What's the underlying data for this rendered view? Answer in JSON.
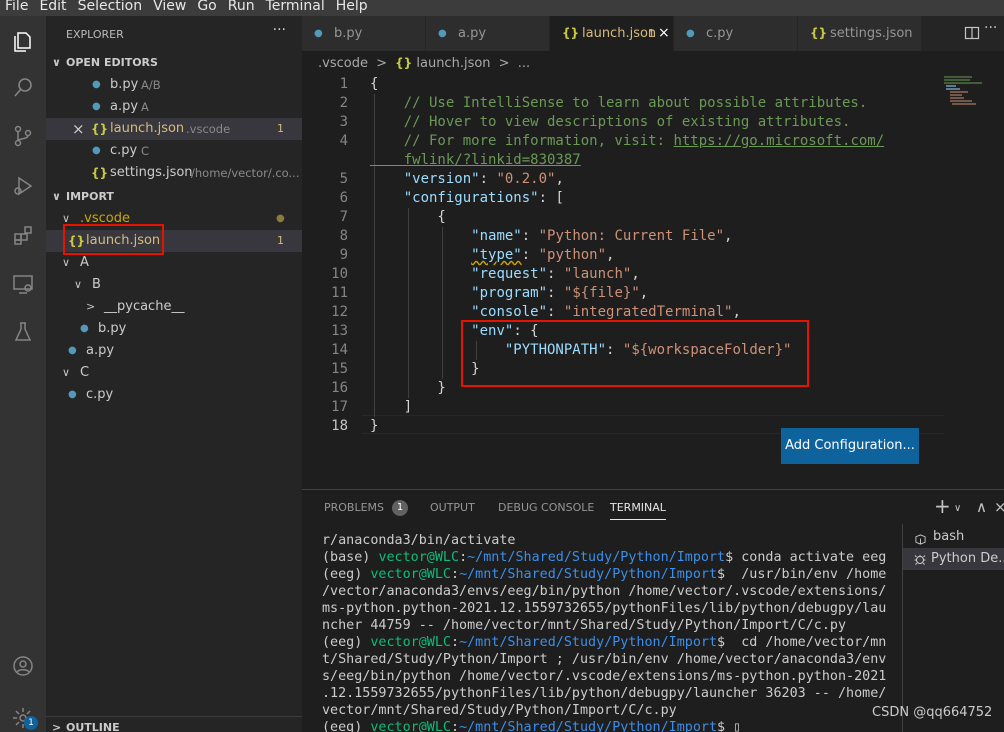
{
  "menu": [
    "File",
    "Edit",
    "Selection",
    "View",
    "Go",
    "Run",
    "Terminal",
    "Help"
  ],
  "activity_badge": "1",
  "explorer": {
    "title": "EXPLORER",
    "more": "···",
    "open_editors_header": "OPEN EDITORS",
    "open_editors": [
      {
        "icon": "py",
        "name": "b.py",
        "desc": "A/B",
        "num": ""
      },
      {
        "icon": "py",
        "name": "a.py",
        "desc": "A",
        "num": ""
      },
      {
        "icon": "json",
        "name": "launch.json",
        "desc": ".vscode",
        "num": "1"
      },
      {
        "icon": "py",
        "name": "c.py",
        "desc": "C",
        "num": ""
      },
      {
        "icon": "json",
        "name": "settings.json",
        "desc": "/home/vector/.co...",
        "num": ""
      }
    ],
    "folder_header": "IMPORT",
    "tree": [
      {
        "type": "folder",
        "name": ".vscode",
        "dot": true
      },
      {
        "type": "json",
        "name": "launch.json",
        "num": "1"
      },
      {
        "type": "folder",
        "name": "A"
      },
      {
        "type": "folder",
        "name": "B"
      },
      {
        "type": "folder-collapsed",
        "name": "__pycache__"
      },
      {
        "type": "py",
        "name": "b.py"
      },
      {
        "type": "py",
        "name": "a.py"
      },
      {
        "type": "folder",
        "name": "C"
      },
      {
        "type": "py",
        "name": "c.py"
      }
    ],
    "outline_header": "OUTLINE"
  },
  "tabs": [
    {
      "icon": "py",
      "label": "b.py"
    },
    {
      "icon": "py",
      "label": "a.py"
    },
    {
      "icon": "json",
      "label": "launch.json",
      "num": "1",
      "close": "×",
      "active": true
    },
    {
      "icon": "py",
      "label": "c.py"
    },
    {
      "icon": "json",
      "label": "settings.json"
    }
  ],
  "tabs_more": "···",
  "breadcrumb": {
    "folder": ".vscode",
    "sep": ">",
    "file_icon": "{}",
    "file": "launch.json",
    "more": "..."
  },
  "editor": {
    "line_numbers": [
      "1",
      "2",
      "3",
      "4",
      "",
      "5",
      "6",
      "7",
      "8",
      "9",
      "10",
      "11",
      "12",
      "13",
      "14",
      "15",
      "16",
      "17",
      "18"
    ],
    "lines": [
      "{",
      "    // Use IntelliSense to learn about possible attributes.",
      "    // Hover to view descriptions of existing attributes.",
      "    // For more information, visit: ",
      "    fwlink/?linkid=830387",
      "    \"version\": \"0.2.0\",",
      "    \"configurations\": [",
      "        {",
      "            \"name\": \"Python: Current File\",",
      "            \"type\": \"python\",",
      "            \"request\": \"launch\",",
      "            \"program\": \"${file}\",",
      "            \"console\": \"integratedTerminal\",",
      "            \"env\": {",
      "                \"PYTHONPATH\": \"${workspaceFolder}\"",
      "            }",
      "        }",
      "    ]",
      "}"
    ],
    "url": "https://go.microsoft.com/",
    "add_configuration": "Add Configuration..."
  },
  "panel": {
    "tabs": [
      "PROBLEMS",
      "OUTPUT",
      "DEBUG CONSOLE",
      "TERMINAL"
    ],
    "problems_count": "1",
    "new_terminal": "+",
    "terminals": [
      {
        "icon": "terminal-icon",
        "label": "bash"
      },
      {
        "icon": "debug-icon",
        "label": "Python De..."
      }
    ],
    "terminal_lines": [
      [
        {
          "t": "r/anaconda3/bin/activate",
          "c": ""
        }
      ],
      [
        {
          "t": "(base) ",
          "c": ""
        },
        {
          "t": "vector@WLC",
          "c": "tg"
        },
        {
          "t": ":",
          "c": ""
        },
        {
          "t": "~/mnt/Shared/Study/Python/Import",
          "c": "tb"
        },
        {
          "t": "$ conda activate eeg",
          "c": ""
        }
      ],
      [
        {
          "t": "(eeg) ",
          "c": ""
        },
        {
          "t": "vector@WLC",
          "c": "tg"
        },
        {
          "t": ":",
          "c": ""
        },
        {
          "t": "~/mnt/Shared/Study/Python/Import",
          "c": "tb"
        },
        {
          "t": "$  /usr/bin/env /home",
          "c": ""
        }
      ],
      [
        {
          "t": "/vector/anaconda3/envs/eeg/bin/python /home/vector/.vscode/extensions/",
          "c": ""
        }
      ],
      [
        {
          "t": "ms-python.python-2021.12.1559732655/pythonFiles/lib/python/debugpy/lau",
          "c": ""
        }
      ],
      [
        {
          "t": "ncher 44759 -- /home/vector/mnt/Shared/Study/Python/Import/C/c.py",
          "c": ""
        }
      ],
      [
        {
          "t": "(eeg) ",
          "c": ""
        },
        {
          "t": "vector@WLC",
          "c": "tg"
        },
        {
          "t": ":",
          "c": ""
        },
        {
          "t": "~/mnt/Shared/Study/Python/Import",
          "c": "tb"
        },
        {
          "t": "$  cd /home/vector/mn",
          "c": ""
        }
      ],
      [
        {
          "t": "t/Shared/Study/Python/Import ; /usr/bin/env /home/vector/anaconda3/env",
          "c": ""
        }
      ],
      [
        {
          "t": "s/eeg/bin/python /home/vector/.vscode/extensions/ms-python.python-2021",
          "c": ""
        }
      ],
      [
        {
          "t": ".12.1559732655/pythonFiles/lib/python/debugpy/launcher 36203 -- /home/",
          "c": ""
        }
      ],
      [
        {
          "t": "vector/mnt/Shared/Study/Python/Import/C/c.py",
          "c": ""
        }
      ],
      [
        {
          "t": "(eeg) ",
          "c": ""
        },
        {
          "t": "vector@WLC",
          "c": "tg"
        },
        {
          "t": ":",
          "c": ""
        },
        {
          "t": "~/mnt/Shared/Study/Python/Import",
          "c": "tb"
        },
        {
          "t": "$ ▯",
          "c": ""
        }
      ]
    ]
  },
  "watermark": "CSDN @qq664752"
}
